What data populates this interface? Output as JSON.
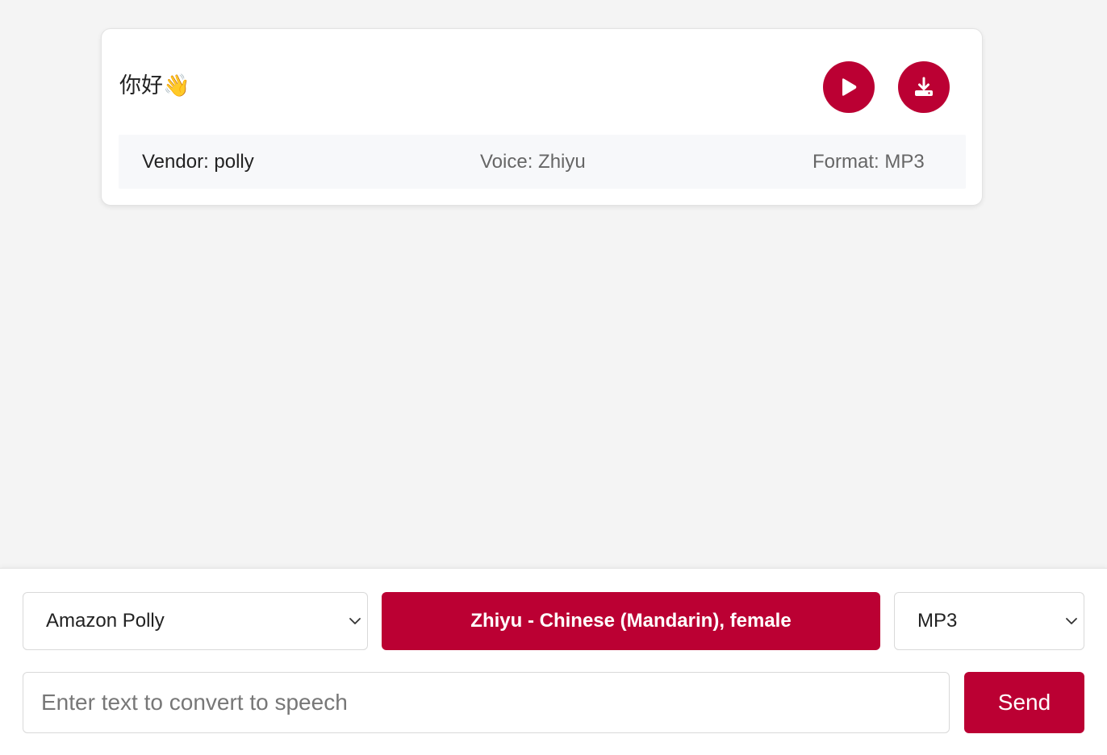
{
  "message": {
    "text": "你好👋",
    "vendor_text": "Vendor: polly",
    "voice_text": "Voice: Zhiyu",
    "format_text": "Format: MP3",
    "play_icon": "play-icon",
    "download_icon": "download-icon"
  },
  "controls": {
    "vendor_select": {
      "selected": "Amazon Polly"
    },
    "voice_button": {
      "label": "Zhiyu - Chinese (Mandarin), female"
    },
    "format_select": {
      "selected": "MP3"
    },
    "text_input": {
      "placeholder": "Enter text to convert to speech",
      "value": ""
    },
    "send_button": {
      "label": "Send"
    }
  },
  "colors": {
    "accent": "#bb0033",
    "background": "#f4f4f4",
    "meta_bar": "#f7f8fa"
  }
}
